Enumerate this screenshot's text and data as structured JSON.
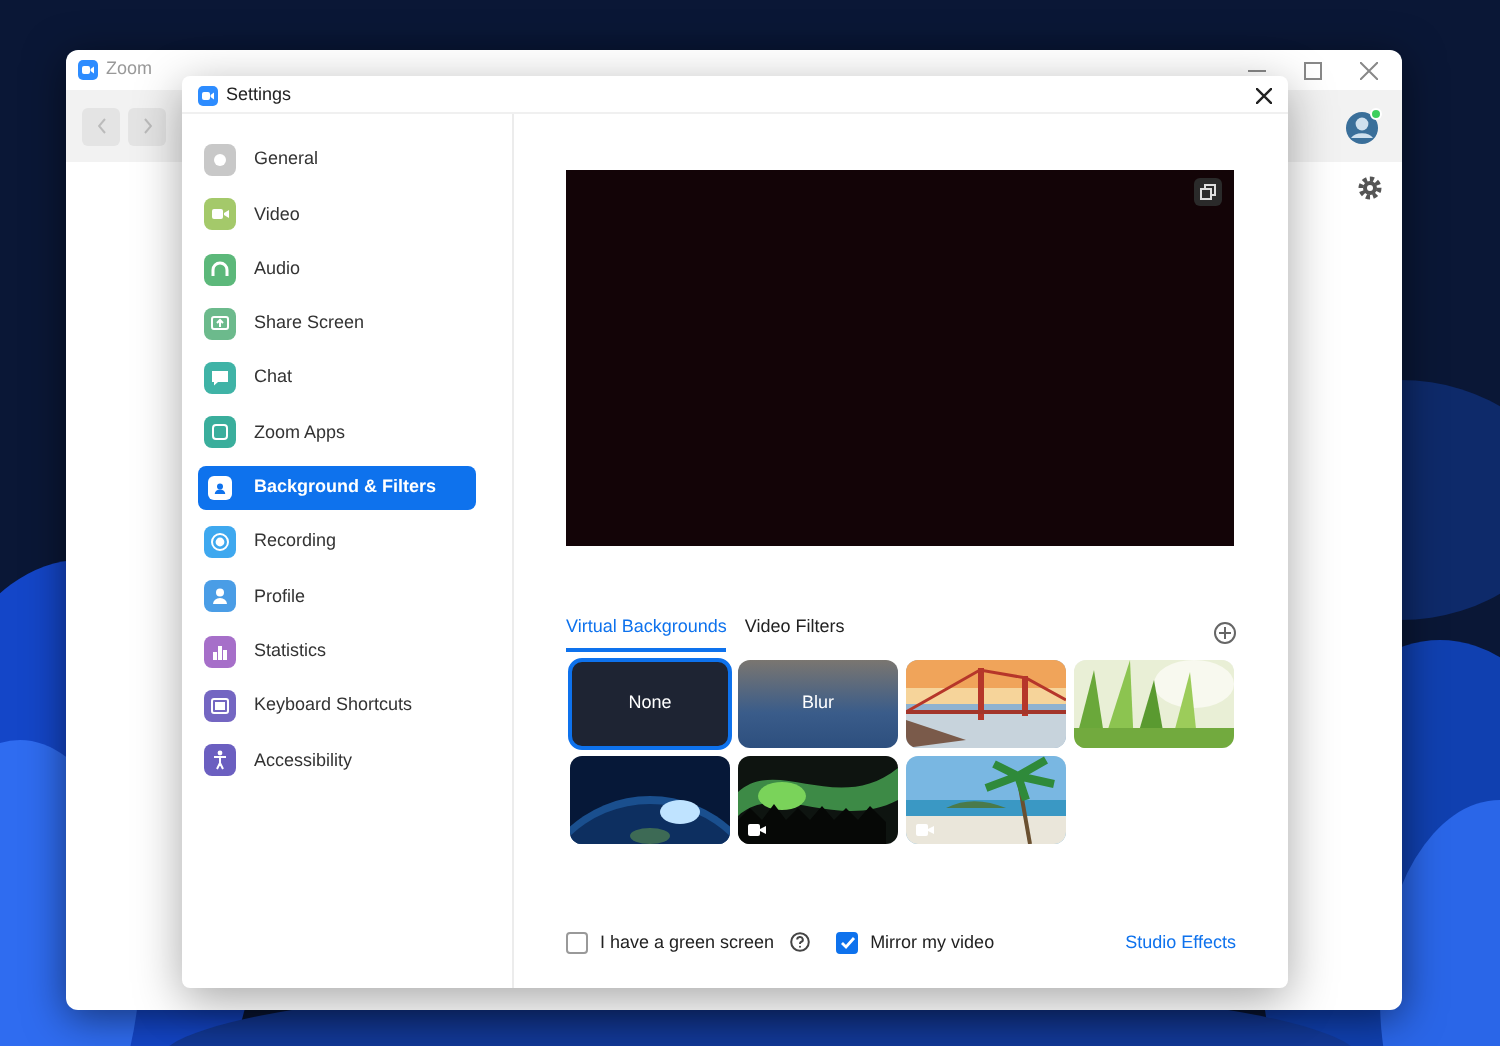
{
  "main_window": {
    "title": "Zoom"
  },
  "settings": {
    "title": "Settings",
    "nav": [
      {
        "label": "General",
        "selected": false,
        "color": "#c8c8c8"
      },
      {
        "label": "Video",
        "selected": false,
        "color": "#a4c96a"
      },
      {
        "label": "Audio",
        "selected": false,
        "color": "#5cb87a"
      },
      {
        "label": "Share Screen",
        "selected": false,
        "color": "#6cba8c"
      },
      {
        "label": "Chat",
        "selected": false,
        "color": "#3fb3a6"
      },
      {
        "label": "Zoom Apps",
        "selected": false,
        "color": "#3aae9c"
      },
      {
        "label": "Background & Filters",
        "selected": true,
        "color": "#ffffff"
      },
      {
        "label": "Recording",
        "selected": false,
        "color": "#3ea8ef"
      },
      {
        "label": "Profile",
        "selected": false,
        "color": "#4a9de6"
      },
      {
        "label": "Statistics",
        "selected": false,
        "color": "#a66fc9"
      },
      {
        "label": "Keyboard Shortcuts",
        "selected": false,
        "color": "#7466c2"
      },
      {
        "label": "Accessibility",
        "selected": false,
        "color": "#6b5fc0"
      }
    ],
    "tabs": [
      {
        "label": "Virtual Backgrounds",
        "selected": true
      },
      {
        "label": "Video Filters",
        "selected": false
      }
    ],
    "backgrounds": [
      {
        "kind": "text",
        "label": "None",
        "selected": true
      },
      {
        "kind": "text",
        "label": "Blur",
        "selected": false
      },
      {
        "kind": "picture",
        "selected": false
      },
      {
        "kind": "picture",
        "selected": false
      },
      {
        "kind": "picture",
        "selected": false
      },
      {
        "kind": "picture",
        "selected": false,
        "video": true
      },
      {
        "kind": "picture",
        "selected": false,
        "video": true
      }
    ],
    "options": [
      {
        "label": "I have a green screen",
        "checked": false,
        "help": true
      },
      {
        "label": "Mirror my video",
        "checked": true,
        "help": false
      }
    ],
    "link": "Studio Effects"
  }
}
